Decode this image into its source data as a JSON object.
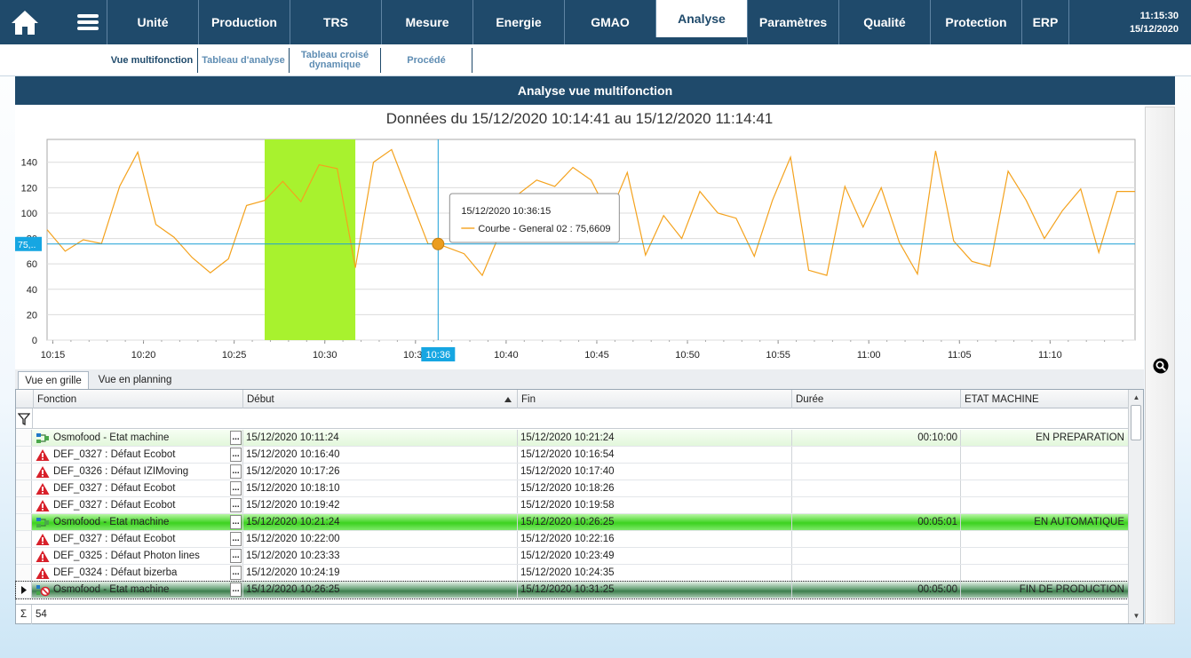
{
  "nav": {
    "items": [
      {
        "label": "Unité"
      },
      {
        "label": "Production"
      },
      {
        "label": "TRS"
      },
      {
        "label": "Mesure"
      },
      {
        "label": "Energie"
      },
      {
        "label": "GMAO"
      },
      {
        "label": "Analyse",
        "active": true
      },
      {
        "label": "Paramètres"
      },
      {
        "label": "Qualité"
      },
      {
        "label": "Protection"
      },
      {
        "label": "ERP"
      }
    ],
    "time": "11:15:30",
    "date": "15/12/2020"
  },
  "subnav": {
    "items": [
      {
        "label": "Vue multifonction"
      },
      {
        "label": "Tableau d'analyse"
      },
      {
        "label": "Tableau croisé dynamique"
      },
      {
        "label": "Procédé"
      }
    ]
  },
  "panel": {
    "title": "Analyse vue multifonction"
  },
  "chart_data": {
    "type": "line",
    "title": "Données du 15/12/2020 10:14:41 au 15/12/2020 11:14:41",
    "ylim": [
      0,
      158
    ],
    "yticks": [
      0,
      20,
      40,
      60,
      80,
      100,
      120,
      140
    ],
    "x_tick_labels": [
      "10:15",
      "10:20",
      "10:25",
      "10:30",
      "10:35",
      "10:40",
      "10:45",
      "10:50",
      "10:55",
      "11:00",
      "11:05",
      "11:10"
    ],
    "series": [
      {
        "name": "Courbe - General 02",
        "color": "#f4a21d",
        "x": [
          "10:14:41",
          "10:15:41",
          "10:16:41",
          "10:17:41",
          "10:18:41",
          "10:19:41",
          "10:20:41",
          "10:21:41",
          "10:22:41",
          "10:23:41",
          "10:24:41",
          "10:25:41",
          "10:26:41",
          "10:27:41",
          "10:28:41",
          "10:29:41",
          "10:30:41",
          "10:31:41",
          "10:32:41",
          "10:33:41",
          "10:34:41",
          "10:35:41",
          "10:36:15",
          "10:37:41",
          "10:38:41",
          "10:39:41",
          "10:40:41",
          "10:41:41",
          "10:42:41",
          "10:43:41",
          "10:44:41",
          "10:45:41",
          "10:46:41",
          "10:47:41",
          "10:48:41",
          "10:49:41",
          "10:50:41",
          "10:51:41",
          "10:52:41",
          "10:53:41",
          "10:54:41",
          "10:55:41",
          "10:56:41",
          "10:57:41",
          "10:58:41",
          "10:59:41",
          "11:00:41",
          "11:01:41",
          "11:02:41",
          "11:03:41",
          "11:04:41",
          "11:05:41",
          "11:06:41",
          "11:07:41",
          "11:08:41",
          "11:09:41",
          "11:10:41",
          "11:11:41",
          "11:12:41",
          "11:13:41",
          "11:14:41"
        ],
        "values": [
          87,
          70,
          79,
          76,
          121,
          148,
          91,
          81,
          65,
          53,
          64,
          106,
          110,
          125,
          109,
          138,
          135,
          57,
          140,
          150,
          113,
          76,
          75.6609,
          68,
          51,
          85,
          115,
          126,
          121,
          136,
          126,
          98,
          132,
          67,
          98,
          80,
          117,
          100,
          96,
          66,
          110,
          144,
          55,
          51,
          121,
          89,
          120,
          77,
          52,
          149,
          78,
          62,
          58,
          133,
          110,
          80,
          102,
          119,
          69,
          117,
          117
        ]
      }
    ],
    "highlight_band": {
      "from": "10:26:41",
      "to": "10:31:41",
      "color": "#a8f22e"
    },
    "cursor": {
      "x": "10:36:15",
      "y": 75.6609,
      "y_label": "75,..",
      "x_label": "10:36"
    },
    "tooltip": {
      "time": "15/12/2020 10:36:15",
      "label": "Courbe - General 02 : 75,6609"
    },
    "grid": true
  },
  "tabs": [
    {
      "label": "Vue en grille",
      "active": true
    },
    {
      "label": "Vue en planning"
    }
  ],
  "grid": {
    "columns": [
      "Fonction",
      "Début",
      "Fin",
      "Durée",
      "ETAT MACHINE"
    ],
    "rows": [
      {
        "kind": "etat",
        "style": "prep",
        "fonction": "Osmofood - Etat machine",
        "debut": "15/12/2020 10:11:24",
        "fin": "15/12/2020 10:21:24",
        "duree": "00:10:00",
        "etat": "EN PREPARATION"
      },
      {
        "kind": "defaut",
        "style": "",
        "fonction": "DEF_0327 : Défaut Ecobot",
        "debut": "15/12/2020 10:16:40",
        "fin": "15/12/2020 10:16:54",
        "duree": "",
        "etat": ""
      },
      {
        "kind": "defaut",
        "style": "",
        "fonction": "DEF_0326 : Défaut IZIMoving",
        "debut": "15/12/2020 10:17:26",
        "fin": "15/12/2020 10:17:40",
        "duree": "",
        "etat": ""
      },
      {
        "kind": "defaut",
        "style": "",
        "fonction": "DEF_0327 : Défaut Ecobot",
        "debut": "15/12/2020 10:18:10",
        "fin": "15/12/2020 10:18:26",
        "duree": "",
        "etat": ""
      },
      {
        "kind": "defaut",
        "style": "",
        "fonction": "DEF_0327 : Défaut Ecobot",
        "debut": "15/12/2020 10:19:42",
        "fin": "15/12/2020 10:19:58",
        "duree": "",
        "etat": ""
      },
      {
        "kind": "etat",
        "style": "auto",
        "fonction": "Osmofood - Etat machine",
        "debut": "15/12/2020 10:21:24",
        "fin": "15/12/2020 10:26:25",
        "duree": "00:05:01",
        "etat": "EN AUTOMATIQUE"
      },
      {
        "kind": "defaut",
        "style": "",
        "fonction": "DEF_0327 : Défaut Ecobot",
        "debut": "15/12/2020 10:22:00",
        "fin": "15/12/2020 10:22:16",
        "duree": "",
        "etat": ""
      },
      {
        "kind": "defaut",
        "style": "",
        "fonction": "DEF_0325 : Défaut Photon lines",
        "debut": "15/12/2020 10:23:33",
        "fin": "15/12/2020 10:23:49",
        "duree": "",
        "etat": ""
      },
      {
        "kind": "defaut",
        "style": "",
        "fonction": "DEF_0324 : Défaut bizerba",
        "debut": "15/12/2020 10:24:19",
        "fin": "15/12/2020 10:24:35",
        "duree": "",
        "etat": ""
      },
      {
        "kind": "etat-fin",
        "style": "fin-prod",
        "fonction": "Osmofood - Etat machine",
        "debut": "15/12/2020 10:26:25",
        "fin": "15/12/2020 10:31:25",
        "duree": "00:05:00",
        "etat": "FIN DE PRODUCTION",
        "current": true
      }
    ],
    "count": "54",
    "dots_label": "...",
    "sigma": "Σ"
  }
}
